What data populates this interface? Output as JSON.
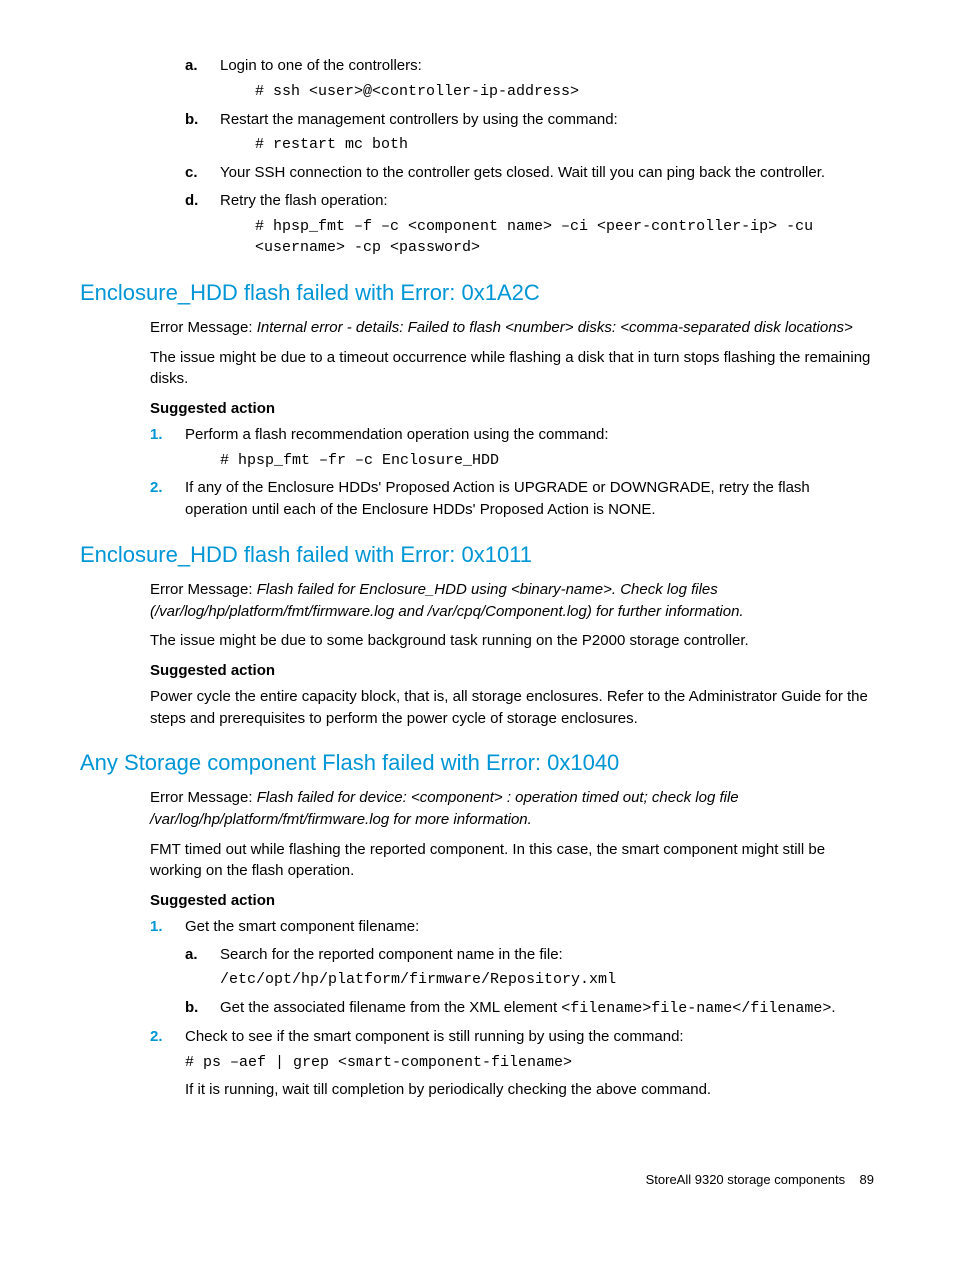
{
  "top_list": {
    "a": {
      "text": "Login to one of the controllers:",
      "code": "# ssh <user>@<controller-ip-address>"
    },
    "b": {
      "text": "Restart the management controllers by using the command:",
      "code": "# restart mc both"
    },
    "c": {
      "text": "Your SSH connection to the controller gets closed. Wait till you can ping back the controller."
    },
    "d": {
      "text": "Retry the flash operation:",
      "code": "# hpsp_fmt –f –c <component name> –ci <peer-controller-ip> -cu <username> -cp <password>"
    }
  },
  "section1": {
    "title": "Enclosure_HDD flash failed with Error: 0x1A2C",
    "err_label": "Error Message: ",
    "err_msg": "Internal error - details: Failed to flash <number> disks: <comma-separated disk locations>",
    "body": "The issue might be due to a timeout occurrence while flashing a disk that in turn stops flashing the remaining disks.",
    "suggested": "Suggested action",
    "step1": "Perform a flash recommendation operation using the command:",
    "step1_code": "# hpsp_fmt –fr –c Enclosure_HDD",
    "step2": "If any of the Enclosure HDDs' Proposed Action is UPGRADE or DOWNGRADE, retry the flash operation until each of the Enclosure HDDs' Proposed Action is NONE."
  },
  "section2": {
    "title": "Enclosure_HDD flash failed with Error: 0x1011",
    "err_label": "Error Message: ",
    "err_msg": "Flash failed for Enclosure_HDD using <binary-name>. Check log files (/var/log/hp/platform/fmt/firmware.log and /var/cpq/Component.log) for further information.",
    "body": "The issue might be due to some background task running on the P2000 storage controller.",
    "suggested": "Suggested action",
    "action": "Power cycle the entire capacity block, that is, all storage enclosures. Refer to the Administrator Guide for the steps and prerequisites to perform the power cycle of storage enclosures."
  },
  "section3": {
    "title": "Any Storage component Flash failed with Error: 0x1040",
    "err_label": "Error Message: ",
    "err_msg": "Flash failed for device: <component> : operation timed out; check log file /var/log/hp/platform/fmt/firmware.log for more information.",
    "body": "FMT timed out while flashing the reported component. In this case, the smart component might still be working on the flash operation.",
    "suggested": "Suggested action",
    "step1": "Get the smart component filename:",
    "step1a": "Search for the reported component name in the file:",
    "step1a_code": "/etc/opt/hp/platform/firmware/Repository.xml",
    "step1b_pre": "Get the associated filename from the XML element ",
    "step1b_code": "<filename>file-name</filename>",
    "step1b_post": ".",
    "step2": "Check to see if the smart component is still running by using the command:",
    "step2_code": "# ps –aef | grep <smart-component-filename>",
    "step2_after": "If it is running, wait till completion by periodically checking the above command."
  },
  "footer": {
    "text": "StoreAll 9320 storage components",
    "page": "89"
  }
}
